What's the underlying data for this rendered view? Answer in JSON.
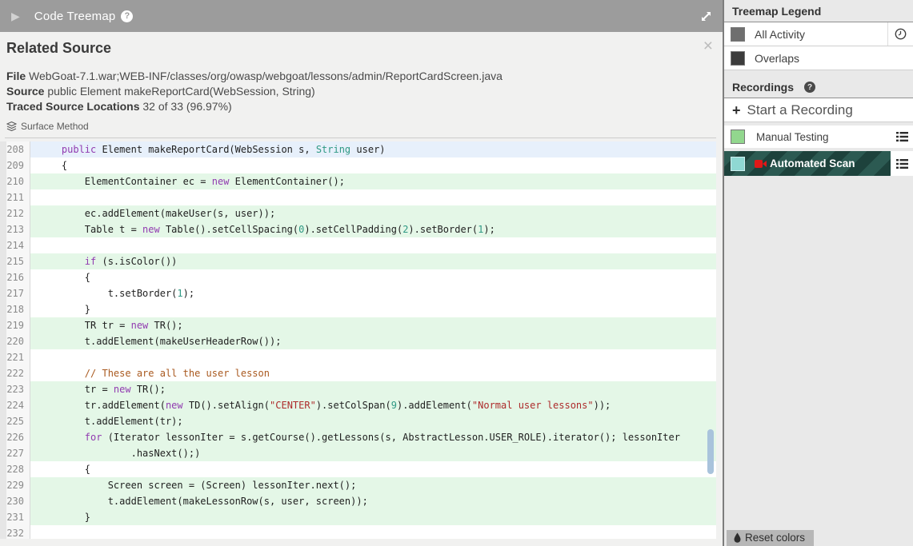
{
  "header": {
    "title": "Code Treemap",
    "help": "?",
    "collapse_icon": "▶"
  },
  "panel": {
    "title": "Related Source",
    "close": "×",
    "file_label": "File",
    "file_value": "WebGoat-7.1.war;WEB-INF/classes/org/owasp/webgoat/lessons/admin/ReportCardScreen.java",
    "source_label": "Source",
    "source_value": "public Element makeReportCard(WebSession, String)",
    "traced_label": "Traced Source Locations",
    "traced_value": "32 of 33 (96.97%)",
    "method_tag": "Surface Method"
  },
  "code": {
    "lines": [
      {
        "num": 208,
        "hl": "b",
        "seg": [
          [
            "    ",
            "p"
          ],
          [
            "public",
            "k"
          ],
          [
            " Element makeReportCard(WebSession s, ",
            "p"
          ],
          [
            "String",
            "t"
          ],
          [
            " user)",
            "p"
          ]
        ]
      },
      {
        "num": 209,
        "hl": "n",
        "seg": [
          [
            "    {",
            "p"
          ]
        ]
      },
      {
        "num": 210,
        "hl": "g",
        "seg": [
          [
            "        ElementContainer ec = ",
            "p"
          ],
          [
            "new",
            "k"
          ],
          [
            " ElementContainer();",
            "p"
          ]
        ]
      },
      {
        "num": 211,
        "hl": "n",
        "seg": []
      },
      {
        "num": 212,
        "hl": "g",
        "seg": [
          [
            "        ec.addElement(makeUser(s, user));",
            "p"
          ]
        ]
      },
      {
        "num": 213,
        "hl": "g",
        "seg": [
          [
            "        Table t = ",
            "p"
          ],
          [
            "new",
            "k"
          ],
          [
            " Table().setCellSpacing(",
            "p"
          ],
          [
            "0",
            "t"
          ],
          [
            ").setCellPadding(",
            "p"
          ],
          [
            "2",
            "t"
          ],
          [
            ").setBorder(",
            "p"
          ],
          [
            "1",
            "t"
          ],
          [
            ");",
            "p"
          ]
        ]
      },
      {
        "num": 214,
        "hl": "n",
        "seg": []
      },
      {
        "num": 215,
        "hl": "g",
        "seg": [
          [
            "        ",
            "p"
          ],
          [
            "if",
            "k"
          ],
          [
            " (s.isColor())",
            "p"
          ]
        ]
      },
      {
        "num": 216,
        "hl": "n",
        "seg": [
          [
            "        {",
            "p"
          ]
        ]
      },
      {
        "num": 217,
        "hl": "n",
        "seg": [
          [
            "            t.setBorder(",
            "p"
          ],
          [
            "1",
            "t"
          ],
          [
            ");",
            "p"
          ]
        ]
      },
      {
        "num": 218,
        "hl": "n",
        "seg": [
          [
            "        }",
            "p"
          ]
        ]
      },
      {
        "num": 219,
        "hl": "g",
        "seg": [
          [
            "        TR tr = ",
            "p"
          ],
          [
            "new",
            "k"
          ],
          [
            " TR();",
            "p"
          ]
        ]
      },
      {
        "num": 220,
        "hl": "g",
        "seg": [
          [
            "        t.addElement(makeUserHeaderRow());",
            "p"
          ]
        ]
      },
      {
        "num": 221,
        "hl": "n",
        "seg": []
      },
      {
        "num": 222,
        "hl": "n",
        "seg": [
          [
            "        ",
            "p"
          ],
          [
            "// These are all the user lesson",
            "c"
          ]
        ]
      },
      {
        "num": 223,
        "hl": "g",
        "seg": [
          [
            "        tr = ",
            "p"
          ],
          [
            "new",
            "k"
          ],
          [
            " TR();",
            "p"
          ]
        ]
      },
      {
        "num": 224,
        "hl": "g",
        "seg": [
          [
            "        tr.addElement(",
            "p"
          ],
          [
            "new",
            "k"
          ],
          [
            " TD().setAlign(",
            "p"
          ],
          [
            "\"CENTER\"",
            "s"
          ],
          [
            ").setColSpan(",
            "p"
          ],
          [
            "9",
            "t"
          ],
          [
            ").addElement(",
            "p"
          ],
          [
            "\"Normal user lessons\"",
            "s"
          ],
          [
            "));",
            "p"
          ]
        ]
      },
      {
        "num": 225,
        "hl": "g",
        "seg": [
          [
            "        t.addElement(tr);",
            "p"
          ]
        ]
      },
      {
        "num": 226,
        "hl": "g",
        "seg": [
          [
            "        ",
            "p"
          ],
          [
            "for",
            "k"
          ],
          [
            " (Iterator lessonIter = s.getCourse().getLessons(s, AbstractLesson.USER_ROLE).iterator(); lessonIter",
            "p"
          ]
        ]
      },
      {
        "num": 227,
        "hl": "g",
        "seg": [
          [
            "                .hasNext();)",
            "p"
          ]
        ]
      },
      {
        "num": 228,
        "hl": "n",
        "seg": [
          [
            "        {",
            "p"
          ]
        ]
      },
      {
        "num": 229,
        "hl": "g",
        "seg": [
          [
            "            Screen screen = (Screen) lessonIter.next();",
            "p"
          ]
        ]
      },
      {
        "num": 230,
        "hl": "g",
        "seg": [
          [
            "            t.addElement(makeLessonRow(s, user, screen));",
            "p"
          ]
        ]
      },
      {
        "num": 231,
        "hl": "g",
        "seg": [
          [
            "        }",
            "p"
          ]
        ]
      },
      {
        "num": 232,
        "hl": "n",
        "seg": []
      }
    ]
  },
  "sidebar": {
    "legend_title": "Treemap Legend",
    "legend_items": [
      {
        "label": "All Activity",
        "color": "#6f6f6f"
      },
      {
        "label": "Overlaps",
        "color": "#3c3c3c"
      }
    ],
    "recordings_title": "Recordings",
    "recordings_help": "?",
    "start_plus": "+",
    "start_label": "Start a Recording",
    "recordings": [
      {
        "label": "Manual Testing",
        "color": "#92d78e"
      },
      {
        "label": "Automated Scan",
        "color": "#8fd8d3"
      }
    ],
    "reset_label": "Reset colors"
  },
  "colors": {
    "header_bar": "#9c9c9c",
    "highlight_green": "#e4f7e7",
    "highlight_blue": "#e7f0fb",
    "selected_recording_bg": "#2c5a52",
    "selected_recording_stripe": "#1d423c",
    "recording_camera": "#e01818",
    "scroll_thumb": "#a9c3dc"
  }
}
